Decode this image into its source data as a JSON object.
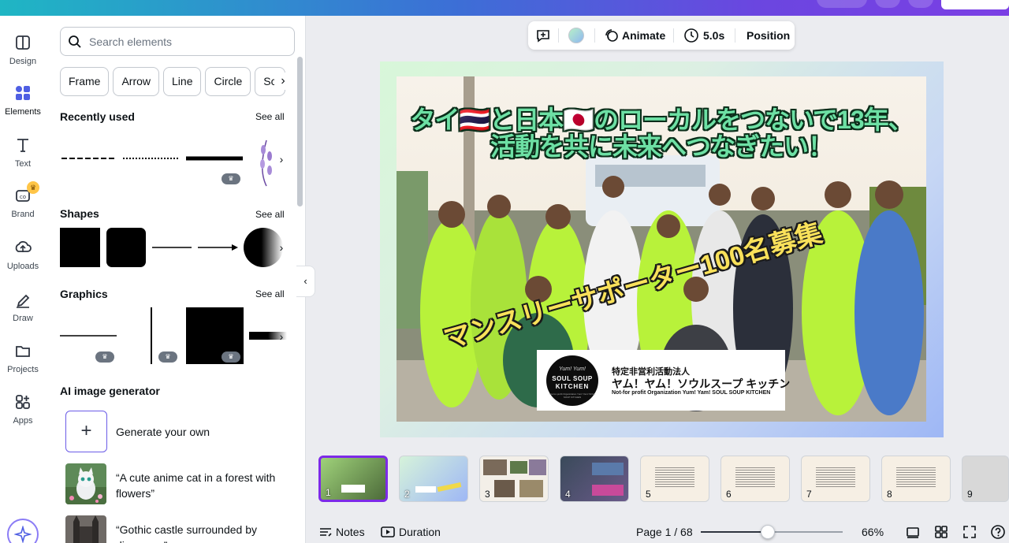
{
  "rail": {
    "items": [
      {
        "label": "Design",
        "icon": "design-icon"
      },
      {
        "label": "Elements",
        "icon": "elements-icon"
      },
      {
        "label": "Text",
        "icon": "text-icon"
      },
      {
        "label": "Brand",
        "icon": "brand-icon"
      },
      {
        "label": "Uploads",
        "icon": "uploads-icon"
      },
      {
        "label": "Draw",
        "icon": "draw-icon"
      },
      {
        "label": "Projects",
        "icon": "projects-icon"
      },
      {
        "label": "Apps",
        "icon": "apps-icon"
      }
    ],
    "active": "Elements"
  },
  "panel": {
    "search_placeholder": "Search elements",
    "chips": [
      "Frame",
      "Arrow",
      "Line",
      "Circle",
      "Sc"
    ],
    "recently_used": {
      "title": "Recently used",
      "see_all": "See all"
    },
    "shapes": {
      "title": "Shapes",
      "see_all": "See all"
    },
    "graphics": {
      "title": "Graphics",
      "see_all": "See all"
    },
    "ai": {
      "title": "AI image generator",
      "generate": "Generate your own",
      "prompts": [
        "“A cute anime cat in a forest with flowers”",
        "“Gothic castle surrounded by dinosaurs”"
      ]
    }
  },
  "toolbar": {
    "animate": "Animate",
    "duration": "5.0s",
    "position": "Position"
  },
  "slide": {
    "headline_line1": "タイ🇹🇭と日本🇯🇵のローカルをつないで13年、",
    "headline_line2": "活動を共に未来へつなぎたい！",
    "banner": "マンスリーサポーター100名募集",
    "logo_l1": "Yum! Yum!",
    "logo_l2": "SOUL SOUP",
    "logo_l3": "KITCHEN",
    "logo_l4": "Not-for-profit Organization Yum! Yam! SOUL SOUP KITCHEN",
    "org_l1": "特定非営利活動法人",
    "org_l2": "ヤム！ヤム！ソウルスープ キッチン",
    "org_l3": "Not-for profit Organization Yum! Yam! SOUL SOUP KITCHEN"
  },
  "thumbnails": [
    "1",
    "2",
    "3",
    "4",
    "5",
    "6",
    "7",
    "8",
    "9"
  ],
  "bottom": {
    "notes": "Notes",
    "duration": "Duration",
    "page": "Page 1 / 68",
    "zoom": "66%",
    "zoom_fraction": 0.47
  },
  "colors": {
    "accent": "#7d2ae8",
    "headline": "#6de0a4",
    "banner": "#f9e15a",
    "shirt": "#b8f23a"
  }
}
